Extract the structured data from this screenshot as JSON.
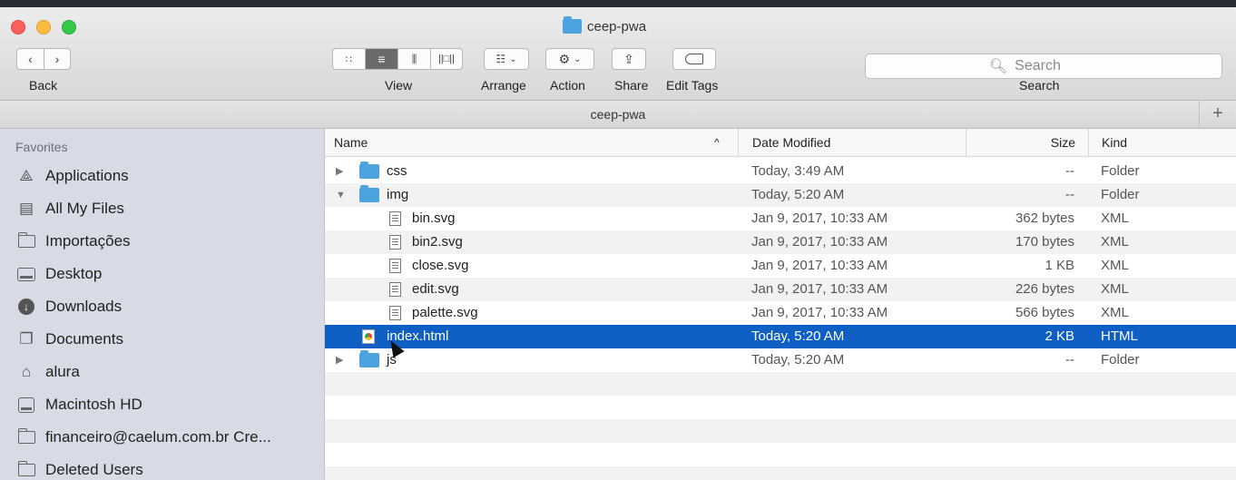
{
  "window": {
    "title": "ceep-pwa"
  },
  "toolbar": {
    "back_label": "Back",
    "view_label": "View",
    "arrange_label": "Arrange",
    "action_label": "Action",
    "share_label": "Share",
    "edit_tags_label": "Edit Tags",
    "search_label": "Search",
    "search_placeholder": "Search"
  },
  "pathbar": {
    "title": "ceep-pwa",
    "plus": "+"
  },
  "sidebar": {
    "heading": "Favorites",
    "items": [
      {
        "label": "Applications",
        "icon": "applications-icon"
      },
      {
        "label": "All My Files",
        "icon": "all-files-icon"
      },
      {
        "label": "Importações",
        "icon": "folder-icon"
      },
      {
        "label": "Desktop",
        "icon": "desktop-icon"
      },
      {
        "label": "Downloads",
        "icon": "downloads-icon"
      },
      {
        "label": "Documents",
        "icon": "documents-icon"
      },
      {
        "label": "alura",
        "icon": "home-icon"
      },
      {
        "label": "Macintosh HD",
        "icon": "hard-disk-icon"
      },
      {
        "label": "financeiro@caelum.com.br Cre...",
        "icon": "folder-icon"
      },
      {
        "label": "Deleted Users",
        "icon": "folder-icon"
      }
    ]
  },
  "columns": {
    "name": "Name",
    "sort_indicator": "^",
    "date": "Date Modified",
    "size": "Size",
    "kind": "Kind"
  },
  "files": [
    {
      "name": "css",
      "date": "Today, 3:49 AM",
      "size": "--",
      "kind": "Folder"
    },
    {
      "name": "img",
      "date": "Today, 5:20 AM",
      "size": "--",
      "kind": "Folder"
    },
    {
      "name": "bin.svg",
      "date": "Jan 9, 2017, 10:33 AM",
      "size": "362 bytes",
      "kind": "XML"
    },
    {
      "name": "bin2.svg",
      "date": "Jan 9, 2017, 10:33 AM",
      "size": "170 bytes",
      "kind": "XML"
    },
    {
      "name": "close.svg",
      "date": "Jan 9, 2017, 10:33 AM",
      "size": "1 KB",
      "kind": "XML"
    },
    {
      "name": "edit.svg",
      "date": "Jan 9, 2017, 10:33 AM",
      "size": "226 bytes",
      "kind": "XML"
    },
    {
      "name": "palette.svg",
      "date": "Jan 9, 2017, 10:33 AM",
      "size": "566 bytes",
      "kind": "XML"
    },
    {
      "name": "index.html",
      "date": "Today, 5:20 AM",
      "size": "2 KB",
      "kind": "HTML"
    },
    {
      "name": "js",
      "date": "Today, 5:20 AM",
      "size": "--",
      "kind": "Folder"
    }
  ],
  "colors": {
    "selection": "#0f5fc4",
    "folder": "#4da3e0",
    "sidebar": "#d7dbe6"
  }
}
